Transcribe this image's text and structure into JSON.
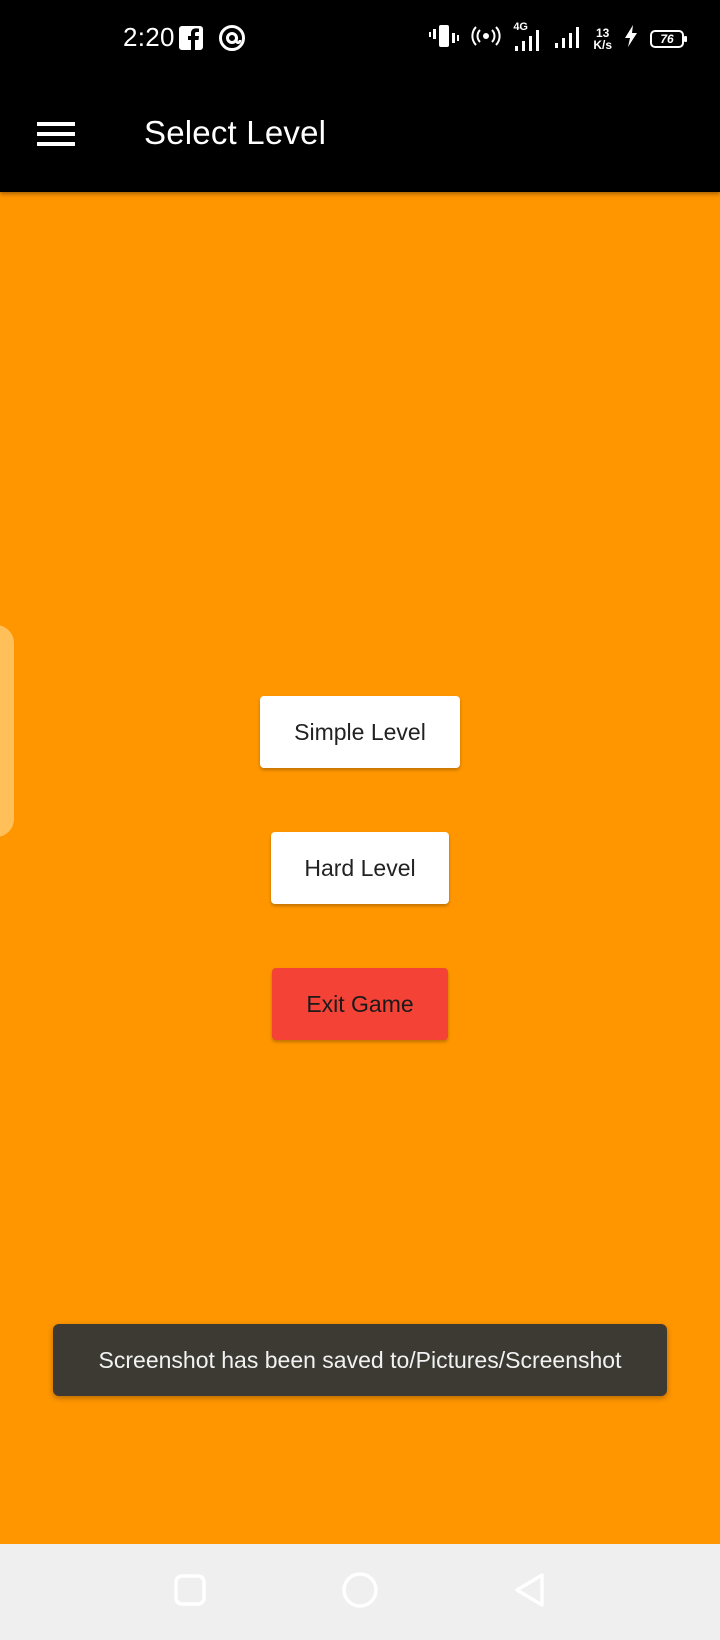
{
  "status_bar": {
    "time": "2:20",
    "network_type": "4G",
    "net_speed_value": "13",
    "net_speed_unit": "K/s",
    "battery_level": "76"
  },
  "app_bar": {
    "title": "Select Level",
    "menu_icon": "hamburger-menu-icon"
  },
  "buttons": {
    "simple": "Simple Level",
    "hard": "Hard Level",
    "exit": "Exit Game"
  },
  "toast": {
    "message": "Screenshot has been saved to/Pictures/Screenshot"
  },
  "nav_bar": {
    "icons": [
      "recent-apps-icon",
      "home-icon",
      "back-icon"
    ]
  },
  "colors": {
    "background": "#ff9600",
    "app_bar": "#000000",
    "exit_button": "#f44336",
    "level_button": "#ffffff",
    "toast": "#3c3a33",
    "nav_bar": "#efefef"
  }
}
